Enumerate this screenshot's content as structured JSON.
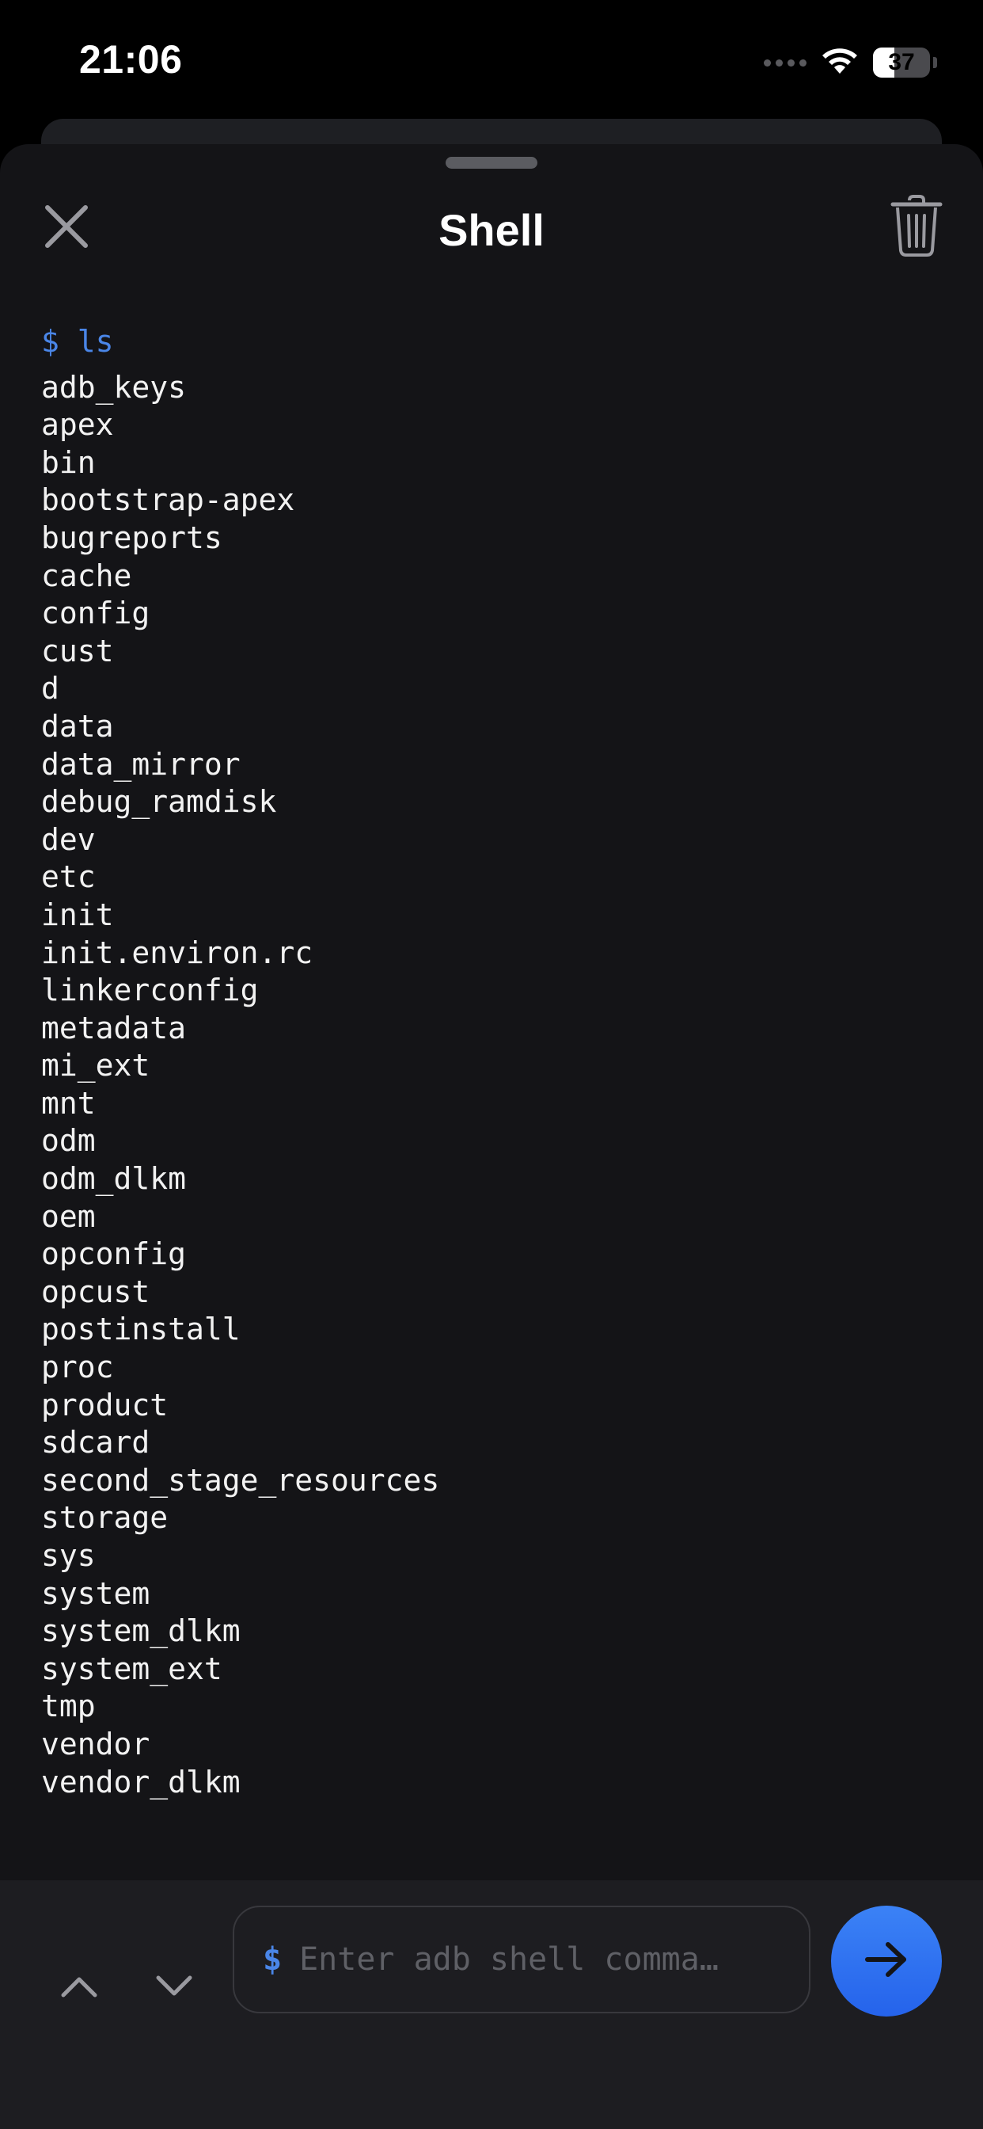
{
  "status_bar": {
    "time": "21:06",
    "battery_percent": "37",
    "battery_level": 0.37
  },
  "header": {
    "title": "Shell",
    "close_icon": "close-icon",
    "clear_icon": "trash-icon"
  },
  "terminal": {
    "command": "$ ls",
    "output": [
      "adb_keys",
      "apex",
      "bin",
      "bootstrap-apex",
      "bugreports",
      "cache",
      "config",
      "cust",
      "d",
      "data",
      "data_mirror",
      "debug_ramdisk",
      "dev",
      "etc",
      "init",
      "init.environ.rc",
      "linkerconfig",
      "metadata",
      "mi_ext",
      "mnt",
      "odm",
      "odm_dlkm",
      "oem",
      "opconfig",
      "opcust",
      "postinstall",
      "proc",
      "product",
      "sdcard",
      "second_stage_resources",
      "storage",
      "sys",
      "system",
      "system_dlkm",
      "system_ext",
      "tmp",
      "vendor",
      "vendor_dlkm"
    ]
  },
  "input_bar": {
    "prompt": "$",
    "placeholder": "Enter adb shell comma…",
    "value": "",
    "history_up_icon": "chevron-up-icon",
    "history_down_icon": "chevron-down-icon",
    "send_icon": "arrow-right-icon"
  },
  "colors": {
    "accent": "#3b82f6",
    "background": "#141417",
    "prompt": "#4a86e8"
  }
}
